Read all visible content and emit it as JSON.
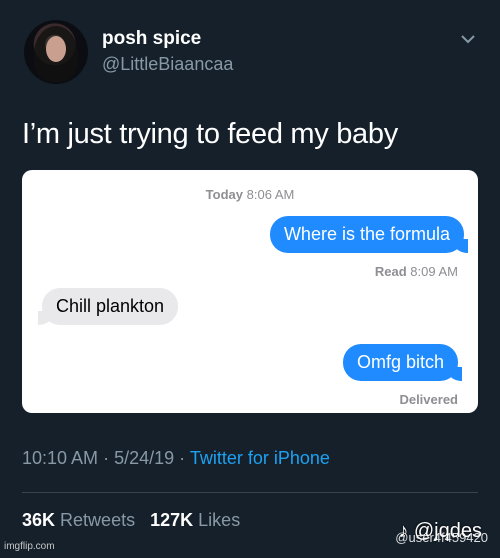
{
  "user": {
    "display_name": "posh spice",
    "handle": "@LittleBiaancaa"
  },
  "tweet": {
    "text": "I’m just trying to feed my baby",
    "time": "10:10 AM",
    "date": "5/24/19",
    "separator": "·",
    "source": "Twitter for iPhone"
  },
  "card": {
    "timestamp_day": "Today",
    "timestamp_time": "8:06 AM",
    "messages": [
      {
        "side": "right",
        "text": "Where is the formula"
      },
      {
        "side": "left",
        "text": "Chill plankton"
      },
      {
        "side": "right",
        "text": "Omfg bitch"
      }
    ],
    "read_label": "Read",
    "read_time": "8:09 AM",
    "delivered": "Delivered"
  },
  "stats": {
    "retweets_count": "36K",
    "retweets_label": "Retweets",
    "likes_count": "127K",
    "likes_label": "Likes"
  },
  "watermarks": {
    "tiktok": "@jqdes",
    "tiktok_id": "@user4f459420",
    "imgflip": "imgflip.com"
  },
  "colors": {
    "background": "#15202b",
    "secondary_text": "#8899a6",
    "link": "#1da1f2",
    "imessage_blue": "#1f8bfe"
  }
}
